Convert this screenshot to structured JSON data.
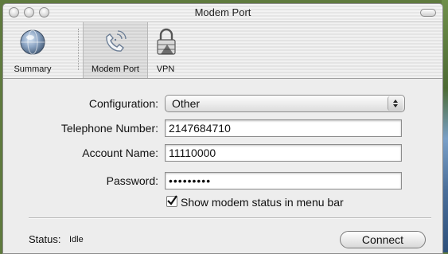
{
  "window": {
    "title": "Modem Port"
  },
  "toolbar": {
    "items": [
      {
        "label": "Summary",
        "icon": "globe-icon"
      },
      {
        "label": "Modem Port",
        "icon": "phone-modem-icon"
      },
      {
        "label": "VPN",
        "icon": "lock-icon"
      }
    ]
  },
  "form": {
    "configuration": {
      "label": "Configuration:",
      "value": "Other"
    },
    "telephone": {
      "label": "Telephone Number:",
      "value": "2147684710"
    },
    "account": {
      "label": "Account Name:",
      "value": "11110000"
    },
    "password": {
      "label": "Password:",
      "value": "•••••••••"
    },
    "show_status": {
      "label": "Show modem status in menu bar",
      "checked": true
    }
  },
  "status": {
    "label": "Status:",
    "value": "Idle"
  },
  "actions": {
    "connect_label": "Connect"
  }
}
